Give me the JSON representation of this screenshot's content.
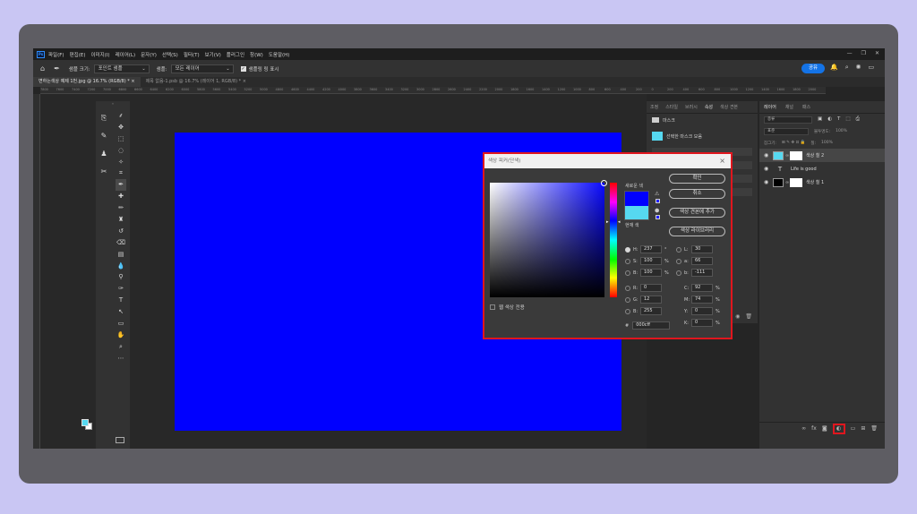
{
  "menubar": {
    "logo": "Ps",
    "items": [
      "파일(F)",
      "편집(E)",
      "이미지(I)",
      "레이어(L)",
      "문자(Y)",
      "선택(S)",
      "필터(T)",
      "보기(V)",
      "플러그인",
      "창(W)",
      "도움말(H)"
    ],
    "window_controls": [
      "—",
      "❐",
      "✕"
    ]
  },
  "options_bar": {
    "sample_size_label": "샘플 크기:",
    "sample_size_value": "포인트 샘플",
    "sample_label": "샘플:",
    "sample_value": "모든 레이어",
    "show_ring_label": "샘플링 링 표시",
    "share_label": "공유"
  },
  "tabs": [
    {
      "label": "변하는색상 예제 1번.jpg @ 16.7% (RGB/8) * ×",
      "active": true
    },
    {
      "label": "제목 없음-1.psb @ 16.7% (레이어 1, RGB/8) * ×",
      "active": false
    }
  ],
  "ruler_ticks": [
    "7800",
    "7600",
    "7400",
    "7200",
    "7000",
    "6800",
    "6600",
    "6400",
    "6200",
    "6000",
    "5800",
    "5600",
    "5400",
    "5200",
    "5000",
    "4800",
    "4600",
    "4400",
    "4200",
    "4000",
    "3800",
    "3600",
    "3400",
    "3200",
    "3000",
    "2800",
    "2600",
    "2400",
    "2200",
    "2000",
    "1800",
    "1600",
    "1400",
    "1200",
    "1000",
    "800",
    "600",
    "400",
    "200",
    "0",
    "200",
    "400",
    "600",
    "800",
    "1000",
    "1200",
    "1400",
    "1600",
    "1800",
    "2000"
  ],
  "properties_panel": {
    "tabs": [
      "조정",
      "스타일",
      "브러시",
      "속성",
      "색상 견본"
    ],
    "active_tab": "속성",
    "mask_label": "마스크",
    "mask_row_label": "선택한 마스크 모음"
  },
  "layers_panel": {
    "tabs": [
      "레이어",
      "채널",
      "패스"
    ],
    "active_tab": "레이어",
    "filter_label": "종류",
    "blend_mode": "표준",
    "opacity_label": "불투명도:",
    "opacity_value": "100%",
    "lock_label": "잠그기:",
    "fill_label": "칠:",
    "fill_value": "100%",
    "layers": [
      {
        "name": "색상 칠 2",
        "type": "fill",
        "thumb_color": "#56d8f0",
        "selected": true
      },
      {
        "name": "Life is good",
        "type": "text",
        "selected": false
      },
      {
        "name": "색상 칠 1",
        "type": "fill",
        "thumb_color": "#000000",
        "selected": false
      }
    ],
    "bottom_icons": [
      "link-icon",
      "fx-icon",
      "mask-icon",
      "adjustment-icon",
      "folder-icon",
      "new-layer-icon",
      "trash-icon"
    ]
  },
  "color_picker": {
    "title": "색상 피커(단색)",
    "new_label": "새로운 색",
    "current_label": "현재 색",
    "new_color": "#0000ff",
    "current_color": "#56d8f0",
    "ok_label": "확인",
    "cancel_label": "취소",
    "add_swatch_label": "색상 견본에 추가",
    "libraries_label": "색상 라이브러리",
    "web_only_label": "웹 색상 전용",
    "fields": {
      "H": {
        "value": "237",
        "unit": "°"
      },
      "S": {
        "value": "100",
        "unit": "%"
      },
      "B": {
        "value": "100",
        "unit": "%"
      },
      "R": {
        "value": "0",
        "unit": ""
      },
      "G": {
        "value": "12",
        "unit": ""
      },
      "Bv": {
        "value": "255",
        "unit": ""
      },
      "L": {
        "value": "30",
        "unit": ""
      },
      "a": {
        "value": "66",
        "unit": ""
      },
      "b": {
        "value": "-111",
        "unit": ""
      },
      "C": {
        "value": "92",
        "unit": "%"
      },
      "M": {
        "value": "74",
        "unit": "%"
      },
      "Y": {
        "value": "0",
        "unit": "%"
      },
      "K": {
        "value": "0",
        "unit": "%"
      }
    },
    "hex_label": "#",
    "hex_value": "000cff"
  },
  "colors": {
    "canvas_blue": "#0000ff",
    "highlight_red": "#e0161e",
    "accent_blue": "#1473e6",
    "swatch_cyan": "#56d8f0"
  }
}
